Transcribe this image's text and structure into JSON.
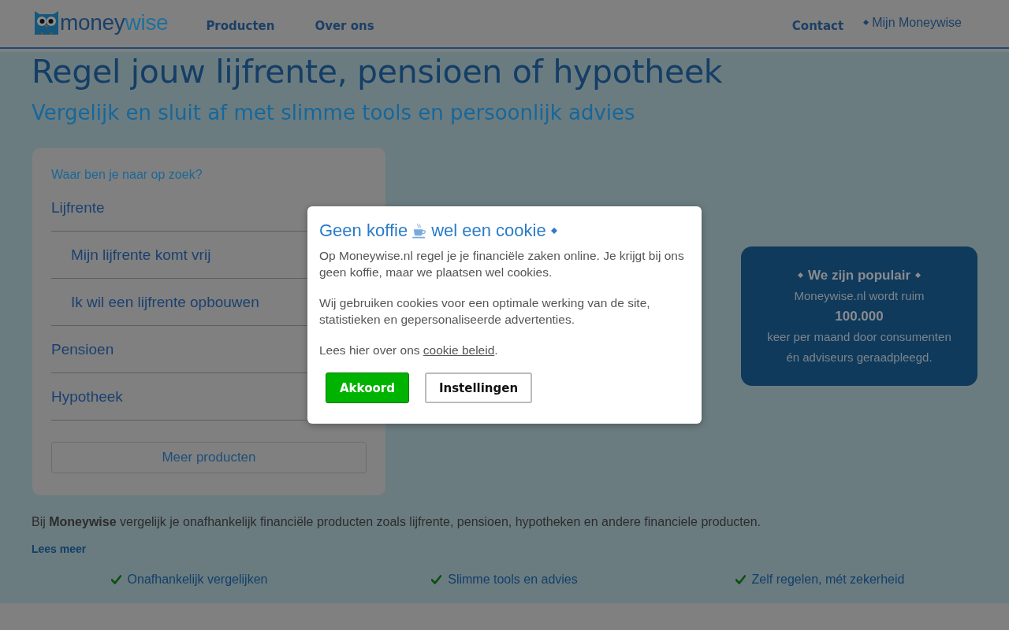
{
  "header": {
    "logo": {
      "parts": [
        "money",
        "wise"
      ]
    },
    "nav": [
      {
        "label": "Producten"
      },
      {
        "label": "Over ons"
      }
    ],
    "nav_right": [
      {
        "label": "Contact",
        "kind": "plain"
      },
      {
        "label": "Mijn Moneywise",
        "kind": "account"
      }
    ]
  },
  "hero": {
    "title": "Regel jouw lijfrente, pensioen of hypotheek",
    "subtitle": "Vergelijk en sluit af met slimme tools en persoonlijk advies"
  },
  "product_finder": {
    "question": "Waar ben je naar op zoek?",
    "items": [
      {
        "label": "Lijfrente",
        "children": [
          {
            "label": "Mijn lijfrente komt vrij"
          },
          {
            "label": "Ik wil een lijfrente opbouwen"
          }
        ]
      },
      {
        "label": "Pensioen"
      },
      {
        "label": "Hypotheek"
      }
    ],
    "more_button": "Meer producten"
  },
  "popular": {
    "title": "We zijn populair",
    "lines": [
      {
        "kind": "text",
        "text": "Moneywise.nl wordt ruim"
      },
      {
        "kind": "figure",
        "text": "100.000"
      },
      {
        "kind": "text",
        "text": "keer per maand door consumenten"
      },
      {
        "kind": "text",
        "text": "én adviseurs geraadpleegd."
      }
    ]
  },
  "intro": {
    "text": "Bij **Moneywise** vergelijk je onafhankelijk financiële producten zoals lijfrente, pensioen, hypotheken en andere financiele producten.",
    "link": "Lees meer"
  },
  "usps": [
    "Onafhankelijk vergelijken",
    "Slimme tools en advies",
    "Zelf regelen, mét zekerheid"
  ],
  "cookie_dialog": {
    "title_start": "Geen koffie",
    "title_end": "wel een cookie",
    "paragraphs": [
      "Op Moneywise.nl regel je je financiële zaken online. Je krijgt bij ons geen koffie, maar we plaatsen wel cookies.",
      "Wij gebruiken cookies voor een optimale werking van de site, statistieken en gepersonaliseerde advertenties."
    ],
    "policy": {
      "text": "Lees hier over ons",
      "link": "cookie beleid",
      "end": "."
    },
    "buttons": [
      {
        "label": "Akkoord",
        "kind": "primary"
      },
      {
        "label": "Instellingen",
        "kind": "secondary"
      }
    ]
  }
}
